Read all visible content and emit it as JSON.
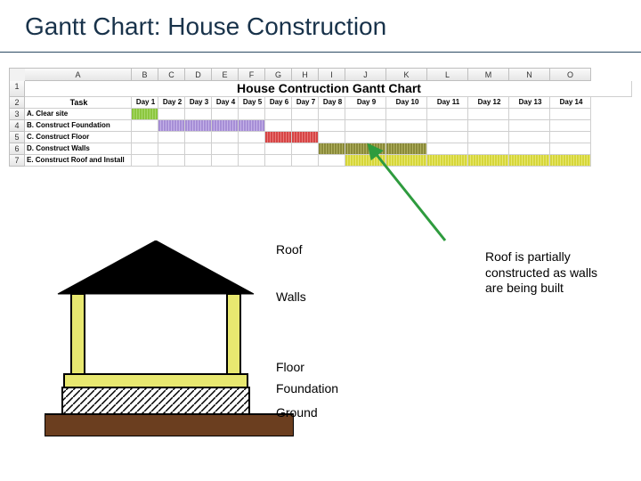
{
  "slide": {
    "title": "Gantt Chart: House Construction"
  },
  "spreadsheet": {
    "columns": [
      "A",
      "B",
      "C",
      "D",
      "E",
      "F",
      "G",
      "H",
      "I",
      "J",
      "K",
      "L",
      "M",
      "N",
      "O"
    ],
    "row_nums": [
      "1",
      "2",
      "3",
      "4",
      "5",
      "6",
      "7"
    ],
    "chart_title": "House Contruction Gantt Chart",
    "task_header": "Task",
    "day_headers": [
      "Day 1",
      "Day 2",
      "Day 3",
      "Day 4",
      "Day 5",
      "Day 6",
      "Day 7",
      "Day 8",
      "Day 9",
      "Day 10",
      "Day 11",
      "Day 12",
      "Day 13",
      "Day 14"
    ],
    "tasks": [
      "A. Clear site",
      "B. Construct Foundation",
      "C. Construct Floor",
      "D. Construct Walls",
      "E. Construct Roof and Install"
    ]
  },
  "chart_data": {
    "type": "bar",
    "categories": [
      "A. Clear site",
      "B. Construct Foundation",
      "C. Construct Floor",
      "D. Construct Walls",
      "E. Construct Roof and Install"
    ],
    "series": [
      {
        "name": "A. Clear site",
        "start_day": 1,
        "end_day": 1,
        "color": "#8cc63f"
      },
      {
        "name": "B. Construct Foundation",
        "start_day": 2,
        "end_day": 5,
        "color": "#a68ed6"
      },
      {
        "name": "C. Construct Floor",
        "start_day": 6,
        "end_day": 7,
        "color": "#d64545"
      },
      {
        "name": "D. Construct Walls",
        "start_day": 8,
        "end_day": 10,
        "color": "#8a8a3a"
      },
      {
        "name": "E. Construct Roof and Install",
        "start_day": 9,
        "end_day": 14,
        "color": "#d6d63a"
      }
    ],
    "title": "House Contruction Gantt Chart",
    "xlabel": "Day",
    "ylabel": "Task",
    "xlim": [
      1,
      14
    ]
  },
  "house_labels": {
    "roof": "Roof",
    "walls": "Walls",
    "floor": "Floor",
    "foundation": "Foundation",
    "ground": "Ground"
  },
  "note": "Roof is partially constructed as walls are being built",
  "colors": {
    "clear_site": "#8cc63f",
    "foundation": "#a68ed6",
    "floor": "#d64545",
    "walls": "#8a8a3a",
    "roof": "#d6d63a",
    "ground": "#6b3e1f"
  }
}
